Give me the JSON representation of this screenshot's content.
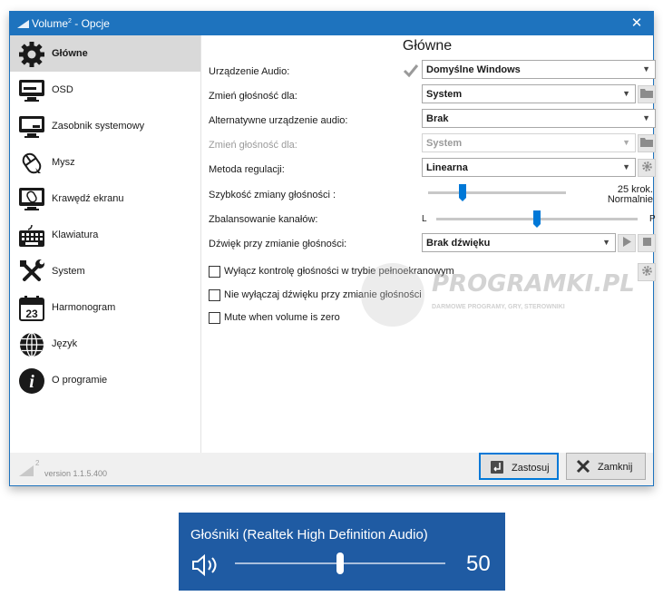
{
  "window": {
    "title_main": "Volume",
    "title_sup": "2",
    "title_rest": " - Opcje",
    "close_glyph": "✕"
  },
  "sidebar": {
    "items": [
      {
        "label": "Główne",
        "icon": "gear-icon",
        "active": true
      },
      {
        "label": "OSD",
        "icon": "monitor-icon"
      },
      {
        "label": "Zasobnik systemowy",
        "icon": "tray-icon"
      },
      {
        "label": "Mysz",
        "icon": "mouse-icon"
      },
      {
        "label": "Krawędź ekranu",
        "icon": "screen-edge-icon"
      },
      {
        "label": "Klawiatura",
        "icon": "keyboard-icon"
      },
      {
        "label": "System",
        "icon": "tools-icon"
      },
      {
        "label": "Harmonogram",
        "icon": "calendar-icon"
      },
      {
        "label": "Język",
        "icon": "globe-icon"
      },
      {
        "label": "O programie",
        "icon": "info-icon"
      }
    ],
    "calendar_day": "23",
    "info_glyph": "i"
  },
  "main": {
    "title": "Główne",
    "fields": {
      "audio_device": {
        "label": "Urządzenie Audio:",
        "value": "Domyślne Windows"
      },
      "volume_for": {
        "label": "Zmień głośność dla:",
        "value": "System"
      },
      "alt_device": {
        "label": "Alternatywne urządzenie audio:",
        "value": "Brak"
      },
      "alt_volume_for": {
        "label": "Zmień głośność dla:",
        "value": "System"
      },
      "method": {
        "label": "Metoda regulacji:",
        "value": "Linearna"
      },
      "speed": {
        "label": "Szybkość zmiany głośności :",
        "value": "25 krok.",
        "sub": "Normalnie",
        "level": 0.25
      },
      "balance": {
        "label": "Zbalansowanie kanałów:",
        "left": "L",
        "right": "P",
        "level": 0.5
      },
      "sound": {
        "label": "Dźwięk przy zmianie głośności:",
        "value": "Brak dźwięku"
      }
    },
    "checkboxes": [
      {
        "label": "Wyłącz kontrolę głośności w trybie pełnoekranowym",
        "checked": false
      },
      {
        "label": "Nie wyłączaj dźwięku przy zmianie głośności",
        "checked": false
      },
      {
        "label": "Mute when volume is zero",
        "checked": false
      }
    ]
  },
  "watermark": {
    "brand": "PROGRAMKI.PL",
    "tagline": "DARMOWE PROGRAMY, GRY, STEROWNIKI"
  },
  "footer": {
    "logo_sup": "2",
    "version": "version 1.1.5.400",
    "apply_label": "Zastosuj",
    "close_label": "Zamknij"
  },
  "flyout": {
    "device": "Głośniki (Realtek High Definition Audio)",
    "volume": "50",
    "level": 0.5
  },
  "colors": {
    "accent": "#1e73be",
    "slider": "#0078d7",
    "flyout_bg": "#1f5ba3"
  }
}
